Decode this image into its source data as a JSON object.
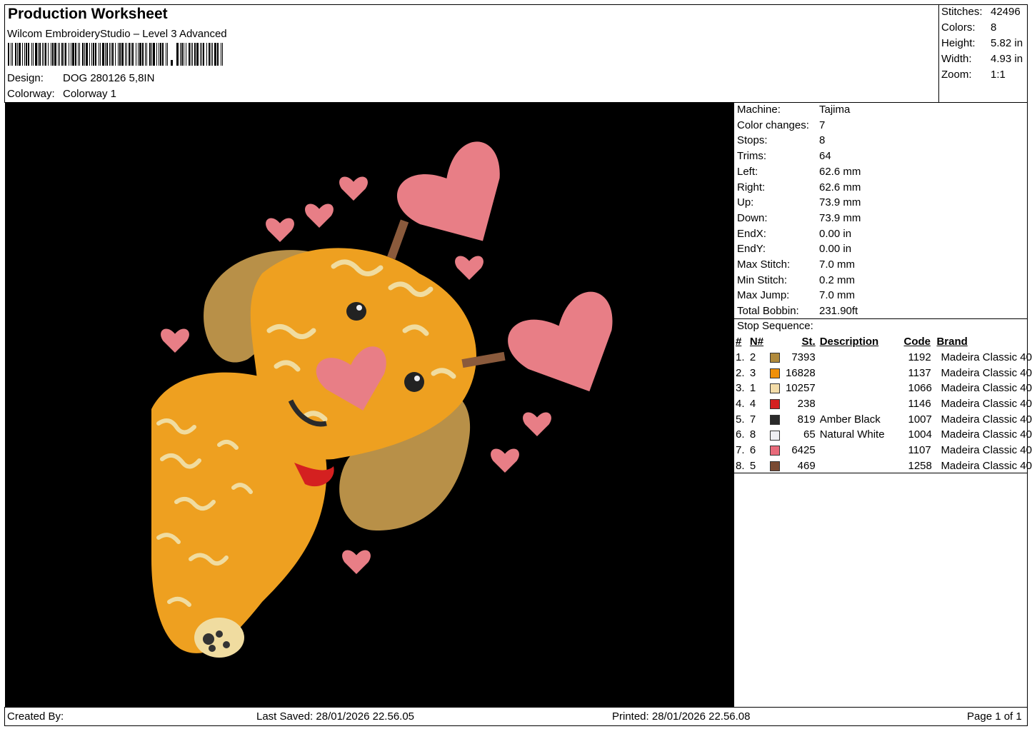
{
  "header": {
    "title": "Production Worksheet",
    "software": "Wilcom EmbroideryStudio – Level 3 Advanced",
    "design_label": "Design:",
    "design_value": "DOG 280126 5,8IN",
    "colorway_label": "Colorway:",
    "colorway_value": "Colorway 1"
  },
  "stats": {
    "stitches_label": "Stitches:",
    "stitches": "42496",
    "colors_label": "Colors:",
    "colors": "8",
    "height_label": "Height:",
    "height": "5.82 in",
    "width_label": "Width:",
    "width": "4.93 in",
    "zoom_label": "Zoom:",
    "zoom": "1:1"
  },
  "machine_info": [
    {
      "label": "Machine:",
      "value": "Tajima"
    },
    {
      "label": "Color changes:",
      "value": "7"
    },
    {
      "label": "Stops:",
      "value": "8"
    },
    {
      "label": "Trims:",
      "value": "64"
    },
    {
      "label": "Left:",
      "value": "62.6 mm"
    },
    {
      "label": "Right:",
      "value": "62.6 mm"
    },
    {
      "label": "Up:",
      "value": "73.9 mm"
    },
    {
      "label": "Down:",
      "value": "73.9 mm"
    },
    {
      "label": "EndX:",
      "value": "0.00 in"
    },
    {
      "label": "EndY:",
      "value": "0.00 in"
    },
    {
      "label": "Max Stitch:",
      "value": "7.0 mm"
    },
    {
      "label": "Min Stitch:",
      "value": "0.2 mm"
    },
    {
      "label": "Max Jump:",
      "value": "7.0 mm"
    },
    {
      "label": "Total Bobbin:",
      "value": "231.90ft"
    }
  ],
  "stop_sequence": {
    "title": "Stop Sequence:",
    "columns": [
      "#",
      "N#",
      "St.",
      "Description",
      "Code",
      "Brand"
    ],
    "rows": [
      {
        "num": "1.",
        "n": "2",
        "color": "#b08a3c",
        "st": "7393",
        "desc": "",
        "code": "1192",
        "brand": "Madeira Classic 40"
      },
      {
        "num": "2.",
        "n": "3",
        "color": "#f0900a",
        "st": "16828",
        "desc": "",
        "code": "1137",
        "brand": "Madeira Classic 40"
      },
      {
        "num": "3.",
        "n": "1",
        "color": "#f3dca8",
        "st": "10257",
        "desc": "",
        "code": "1066",
        "brand": "Madeira Classic 40"
      },
      {
        "num": "4.",
        "n": "4",
        "color": "#d42020",
        "st": "238",
        "desc": "",
        "code": "1146",
        "brand": "Madeira Classic 40"
      },
      {
        "num": "5.",
        "n": "7",
        "color": "#2a2a2a",
        "st": "819",
        "desc": "Amber Black",
        "code": "1007",
        "brand": "Madeira Classic 40"
      },
      {
        "num": "6.",
        "n": "8",
        "color": "#eeeef2",
        "st": "65",
        "desc": "Natural White",
        "code": "1004",
        "brand": "Madeira Classic 40"
      },
      {
        "num": "7.",
        "n": "6",
        "color": "#e86a7a",
        "st": "6425",
        "desc": "",
        "code": "1107",
        "brand": "Madeira Classic 40"
      },
      {
        "num": "8.",
        "n": "5",
        "color": "#7a4a32",
        "st": "469",
        "desc": "",
        "code": "1258",
        "brand": "Madeira Classic 40"
      }
    ]
  },
  "footer": {
    "created_by": "Created By:",
    "last_saved": "Last Saved: 28/01/2026 22.56.05",
    "printed": "Printed: 28/01/2026 22.56.08",
    "page": "Page 1 of 1"
  },
  "canvas_colors": {
    "background": "#000000",
    "tan": "#b89048",
    "orange": "#eea020",
    "cream": "#f0dca0",
    "pink": "#e87e86",
    "brown": "#8a5a3c"
  }
}
